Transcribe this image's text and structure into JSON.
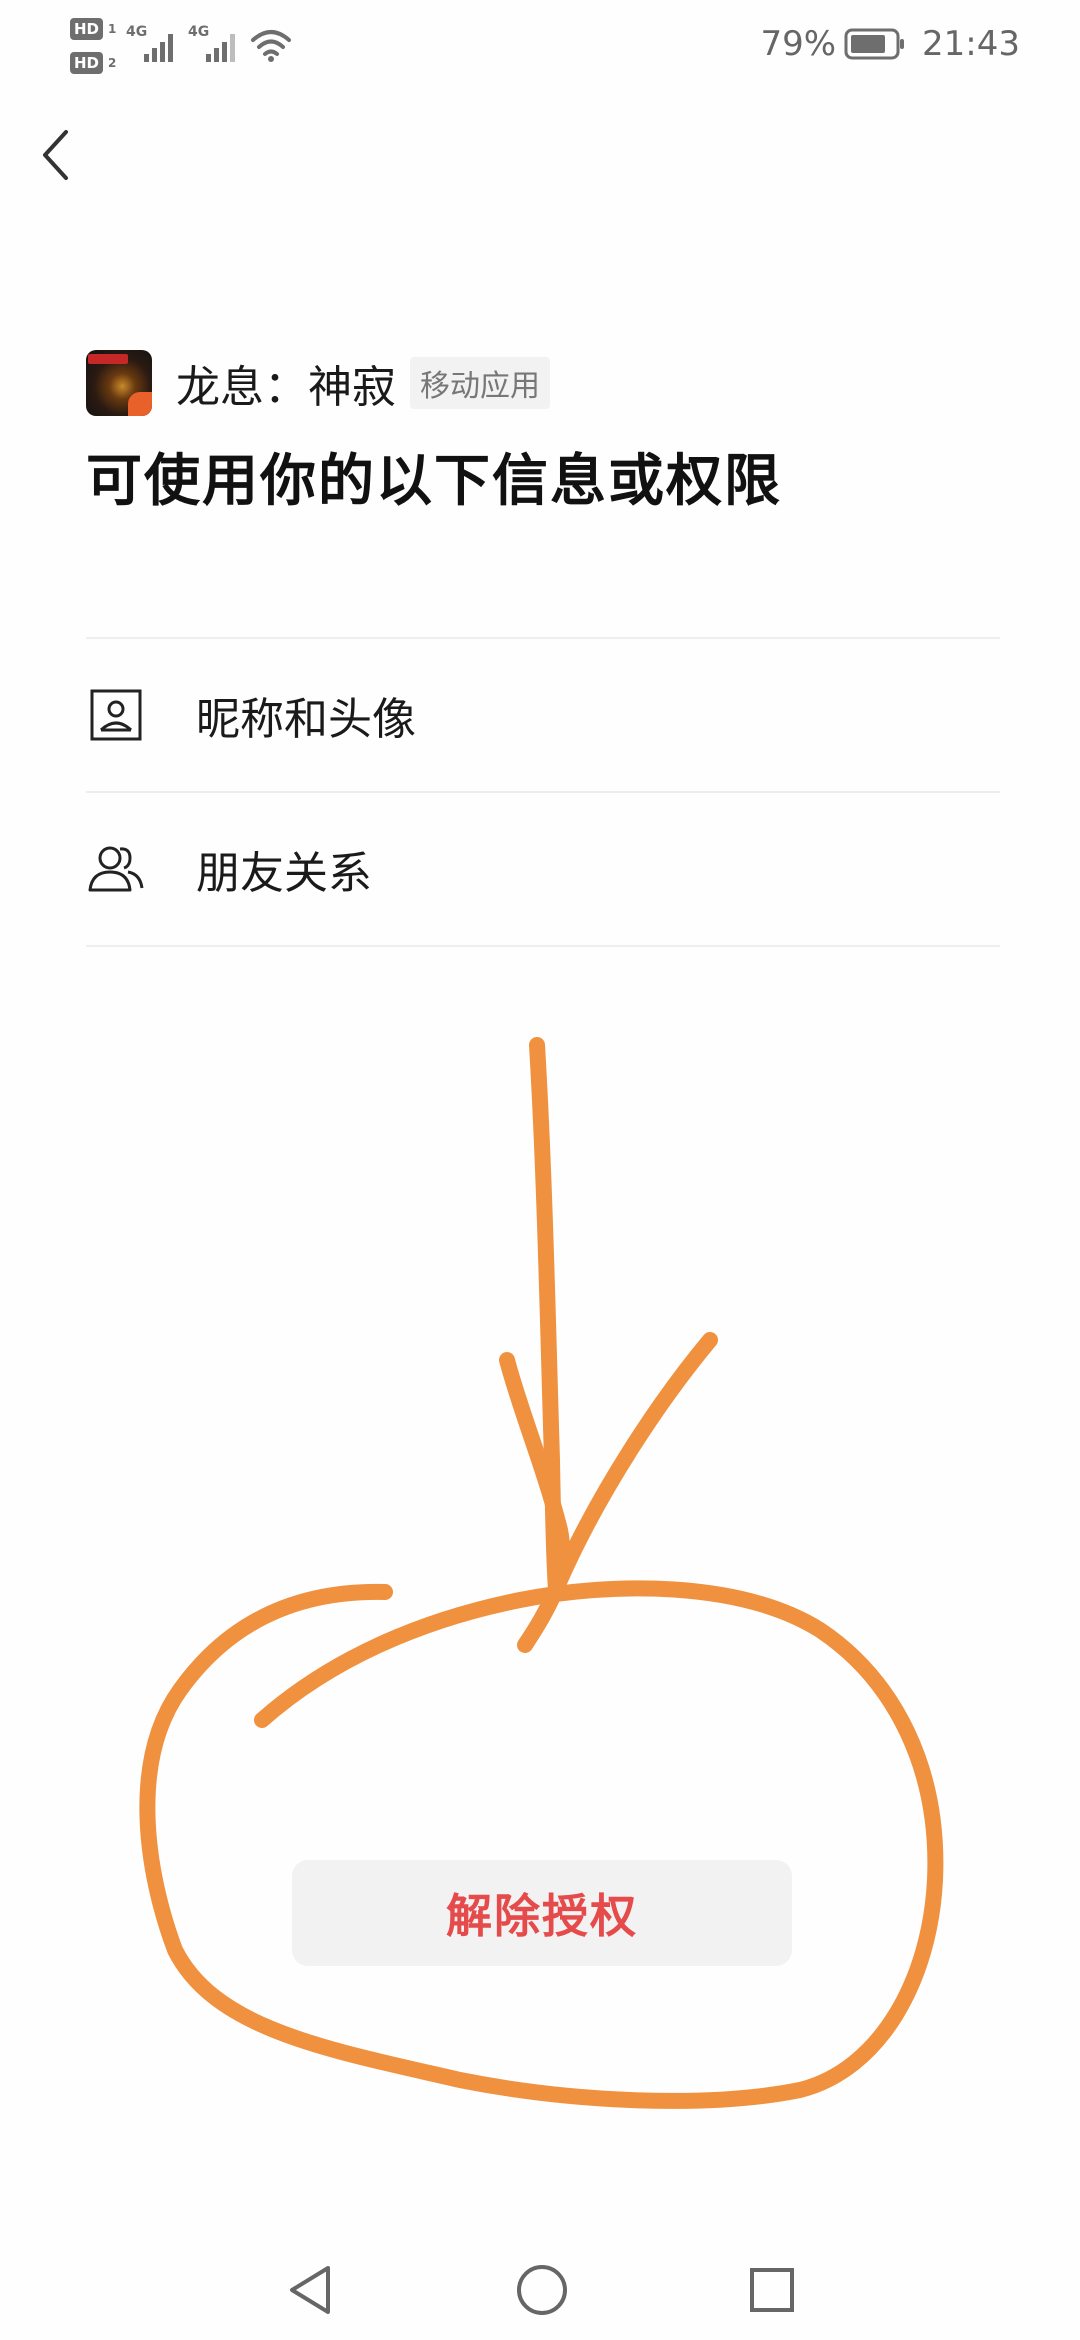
{
  "status_bar": {
    "sim1_badge": "HD",
    "sim1_num": "1",
    "sim2_badge": "HD",
    "sim2_num": "2",
    "net1": "4G",
    "net2": "4G",
    "battery_percent": "79%",
    "time": "21:43",
    "icons": [
      "signal-icon",
      "wifi-icon",
      "battery-icon"
    ]
  },
  "header": {
    "back_icon": "chevron-left-icon"
  },
  "app": {
    "name": "龙息：神寂",
    "tag": "移动应用",
    "icon": "app-icon"
  },
  "headline": "可使用你的以下信息或权限",
  "permissions": [
    {
      "icon": "id-card-icon",
      "label": "昵称和头像"
    },
    {
      "icon": "friends-icon",
      "label": "朋友关系"
    }
  ],
  "revoke_button": {
    "label": "解除授权",
    "color": "#e64b4b"
  },
  "annotation": {
    "color": "#f0913f",
    "shapes": [
      "arrow",
      "circle"
    ]
  },
  "nav_bar": {
    "icons": [
      "back-triangle-icon",
      "home-circle-icon",
      "recents-square-icon"
    ]
  }
}
